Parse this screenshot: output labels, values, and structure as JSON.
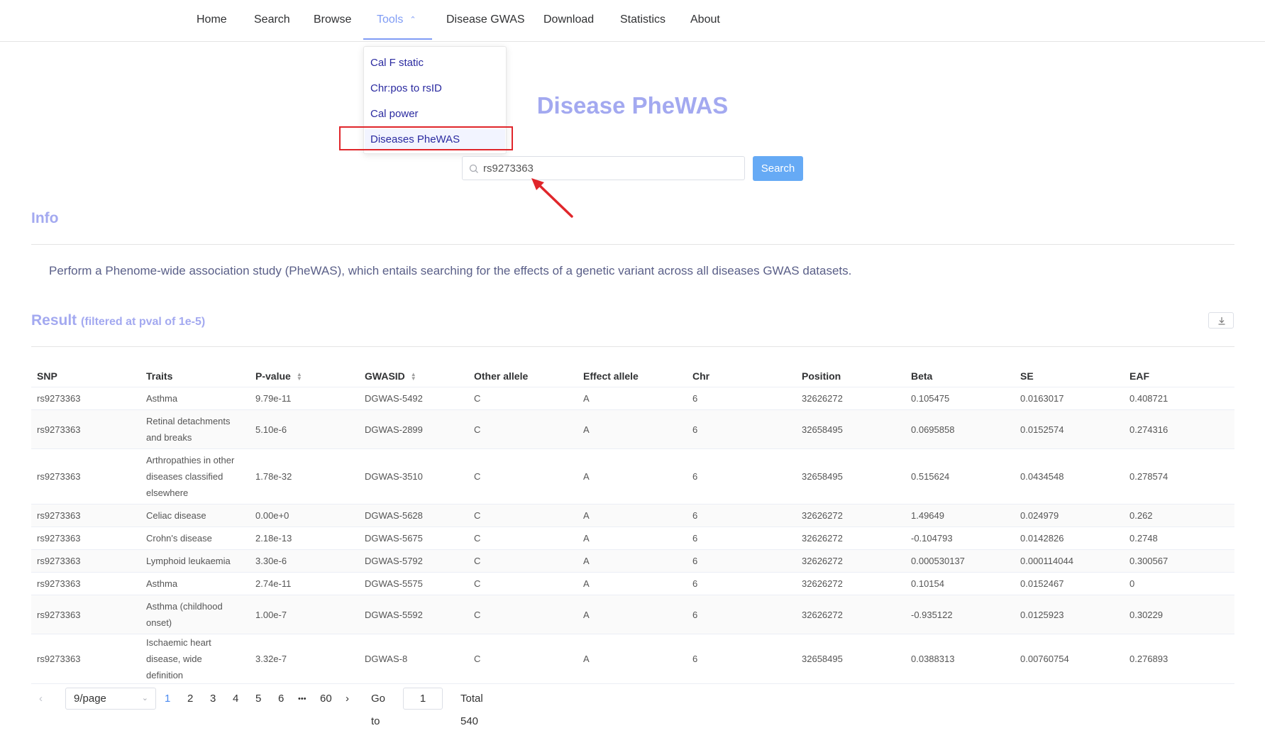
{
  "nav": {
    "items": [
      "Home",
      "Search",
      "Browse",
      "Tools",
      "Disease GWAS",
      "Download",
      "Statistics",
      "About"
    ],
    "active": "Tools"
  },
  "tools_menu": {
    "items": [
      "Cal F static",
      "Chr:pos to rsID",
      "Cal power",
      "Diseases PheWAS"
    ],
    "highlighted": "Diseases PheWAS"
  },
  "page_title": "Disease PheWAS",
  "search": {
    "value": "rs9273363",
    "button_label": "Search"
  },
  "info": {
    "heading": "Info",
    "text": "Perform a Phenome-wide association study (PheWAS), which entails searching for the effects of a genetic variant across all diseases GWAS datasets."
  },
  "result": {
    "heading": "Result",
    "subheading": "(filtered at pval of 1e-5)",
    "columns": [
      "SNP",
      "Traits",
      "P-value",
      "GWASID",
      "Other allele",
      "Effect allele",
      "Chr",
      "Position",
      "Beta",
      "SE",
      "EAF"
    ],
    "rows": [
      [
        "rs9273363",
        "Asthma",
        "9.79e-11",
        "DGWAS-5492",
        "C",
        "A",
        "6",
        "32626272",
        "0.105475",
        "0.0163017",
        "0.408721"
      ],
      [
        "rs9273363",
        "Retinal detachments and breaks",
        "5.10e-6",
        "DGWAS-2899",
        "C",
        "A",
        "6",
        "32658495",
        "0.0695858",
        "0.0152574",
        "0.274316"
      ],
      [
        "rs9273363",
        "Arthropathies in other diseases classified elsewhere",
        "1.78e-32",
        "DGWAS-3510",
        "C",
        "A",
        "6",
        "32658495",
        "0.515624",
        "0.0434548",
        "0.278574"
      ],
      [
        "rs9273363",
        "Celiac disease",
        "0.00e+0",
        "DGWAS-5628",
        "C",
        "A",
        "6",
        "32626272",
        "1.49649",
        "0.024979",
        "0.262"
      ],
      [
        "rs9273363",
        "Crohn's disease",
        "2.18e-13",
        "DGWAS-5675",
        "C",
        "A",
        "6",
        "32626272",
        "-0.104793",
        "0.0142826",
        "0.2748"
      ],
      [
        "rs9273363",
        "Lymphoid leukaemia",
        "3.30e-6",
        "DGWAS-5792",
        "C",
        "A",
        "6",
        "32626272",
        "0.000530137",
        "0.000114044",
        "0.300567"
      ],
      [
        "rs9273363",
        "Asthma",
        "2.74e-11",
        "DGWAS-5575",
        "C",
        "A",
        "6",
        "32626272",
        "0.10154",
        "0.0152467",
        "0"
      ],
      [
        "rs9273363",
        "Asthma (childhood onset)",
        "1.00e-7",
        "DGWAS-5592",
        "C",
        "A",
        "6",
        "32626272",
        "-0.935122",
        "0.0125923",
        "0.30229"
      ],
      [
        "rs9273363",
        "Ischaemic heart disease, wide definition",
        "3.32e-7",
        "DGWAS-8",
        "C",
        "A",
        "6",
        "32658495",
        "0.0388313",
        "0.00760754",
        "0.276893"
      ]
    ]
  },
  "pagination": {
    "page_size": "9/page",
    "pages": [
      "1",
      "2",
      "3",
      "4",
      "5",
      "6",
      "•••",
      "60"
    ],
    "current": "1",
    "goto_label": "Go to",
    "goto_value": "1",
    "total": "Total 540"
  },
  "colors": {
    "accent": "#a3a9f0",
    "link": "#7f9cf5",
    "button": "#66aaf5",
    "highlight_box": "#e0262b"
  }
}
